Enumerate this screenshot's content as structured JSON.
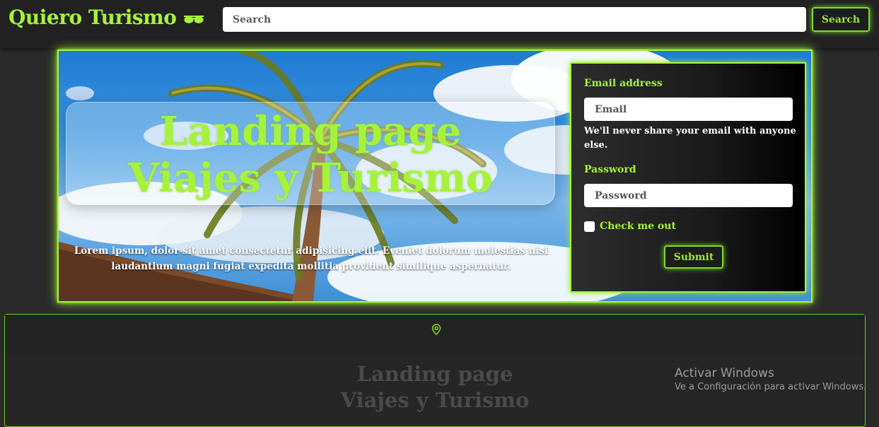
{
  "header": {
    "brand": "Quiero Turismo",
    "brand_icon": "sunglasses-icon",
    "search_placeholder": "Search",
    "search_button": "Search"
  },
  "hero": {
    "title_line1": "Landing page",
    "title_line2": "Viajes y Turismo",
    "text": "Lorem ipsum, dolor sit amet consectetur adipisicing elit. Eveniet dolorum molestias nisi laudantium magni fugiat expedita mollitia provident similique aspernatur."
  },
  "login": {
    "email_label": "Email address",
    "email_placeholder": "Email",
    "email_help": "We'll never share your email with anyone else.",
    "password_label": "Password",
    "password_placeholder": "Password",
    "check_label": "Check me out",
    "submit_label": "Submit"
  },
  "footer": {
    "icon": "location-pin-icon",
    "title_line1": "Landing page",
    "title_line2": "Viajes y Turismo"
  },
  "windows_watermark": {
    "title": "Activar Windows",
    "subtitle": "Ve a Configuración para activar Windows."
  },
  "colors": {
    "accent": "#a6f23a",
    "background": "#2a2a2a"
  }
}
